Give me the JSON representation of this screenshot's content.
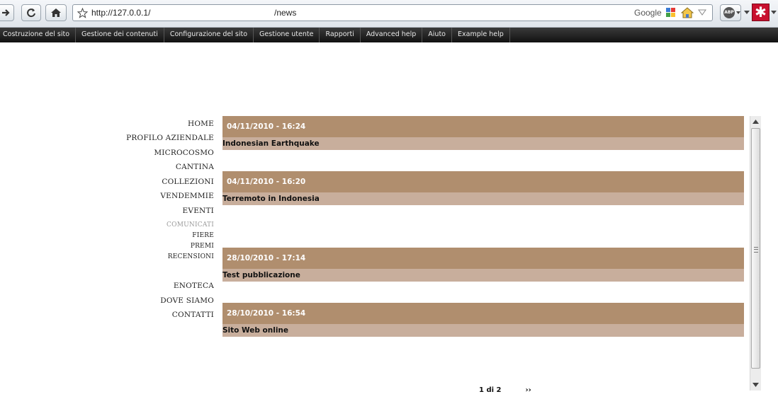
{
  "browser": {
    "url_host": "http://127.0.0.1/",
    "url_path": "/news",
    "search_engine": "Google",
    "adblock_label": "ABP"
  },
  "admin_menu": {
    "items": [
      {
        "label": "Costruzione del sito"
      },
      {
        "label": "Gestione dei contenuti"
      },
      {
        "label": "Configurazione del sito"
      },
      {
        "label": "Gestione utente"
      },
      {
        "label": "Rapporti"
      },
      {
        "label": "Advanced help"
      },
      {
        "label": "Aiuto"
      },
      {
        "label": "Example help"
      }
    ]
  },
  "site_menu": {
    "items": [
      {
        "label": "HOME"
      },
      {
        "label": "PROFILO AZIENDALE"
      },
      {
        "label": "MICROCOSMO"
      },
      {
        "label": "CANTINA"
      },
      {
        "label": "COLLEZIONI"
      },
      {
        "label": "VENDEMMIE"
      },
      {
        "label": "EVENTI"
      },
      {
        "label": "COMUNICATI"
      },
      {
        "label": "FIERE"
      },
      {
        "label": "PREMI"
      },
      {
        "label": "RECENSIONI"
      },
      {
        "label": "ENOTECA"
      },
      {
        "label": "DOVE SIAMO"
      },
      {
        "label": "CONTATTI"
      }
    ]
  },
  "news": {
    "items": [
      {
        "date": "04/11/2010 - 16:24",
        "title": "Indonesian Earthquake"
      },
      {
        "date": "04/11/2010 - 16:20",
        "title": "Terremoto in Indonesia"
      },
      {
        "date": "28/10/2010 - 17:14",
        "title": "Test pubblicazione"
      },
      {
        "date": "28/10/2010 - 16:54",
        "title": "Sito Web online"
      }
    ]
  },
  "pager": {
    "status": "1 di 2",
    "next": "››"
  },
  "colors": {
    "date_bar": "#b08e6e",
    "title_bar": "#c8ae9c",
    "admin_bar": "#1a1a1a"
  }
}
